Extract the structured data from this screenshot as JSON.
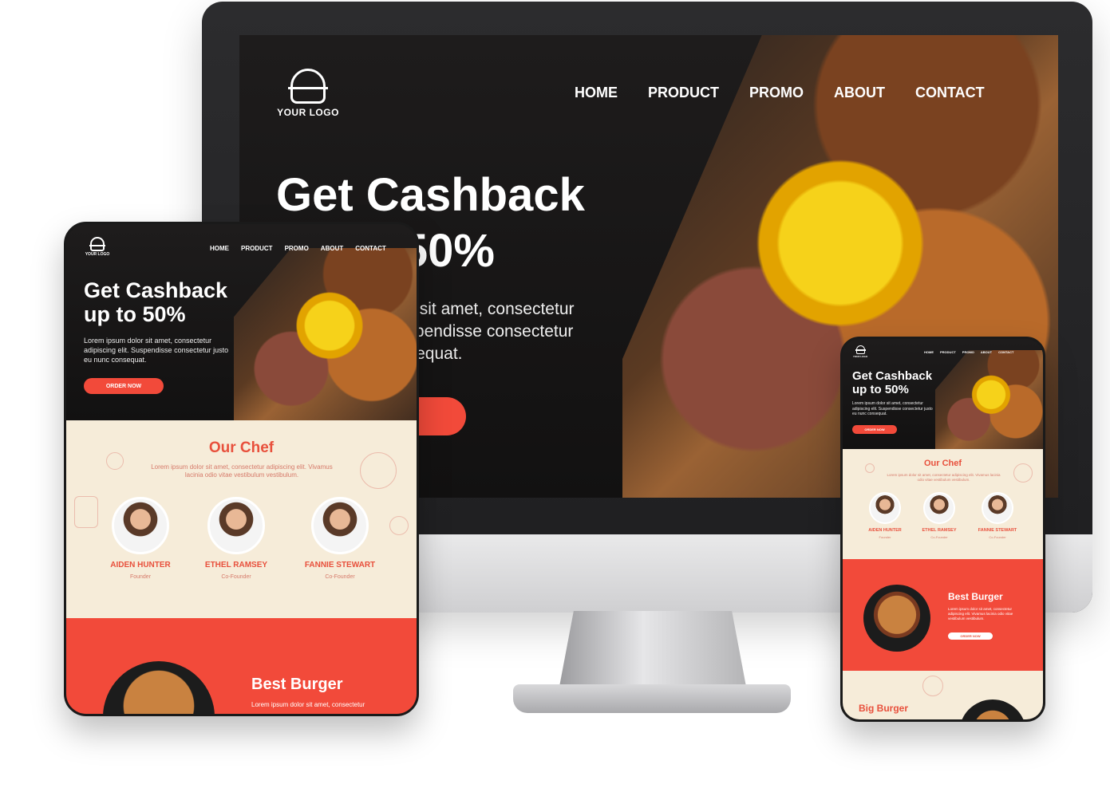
{
  "brand": {
    "logo_text": "YOUR LOGO",
    "accent": "#f24a3a",
    "dark": "#151414",
    "cream": "#f6ecd9"
  },
  "nav": [
    "HOME",
    "PRODUCT",
    "PROMO",
    "ABOUT",
    "CONTACT"
  ],
  "desktop": {
    "hero_title": "Get Cashback up to 50%",
    "hero_desc": "Lorem ipsum dolor sit amet, consectetur adipiscing elit. Suspendisse consectetur justo eu nunc consequat.",
    "cta": "ORDER NOW"
  },
  "tablet": {
    "hero_title": "Get Cashback up to 50%",
    "hero_desc": "Lorem ipsum dolor sit amet, consectetur adipiscing elit. Suspendisse consectetur justo eu nunc consequat.",
    "cta": "ORDER NOW",
    "chef_title": "Our Chef",
    "chef_desc": "Lorem ipsum dolor sit amet, consectetur adipiscing elit. Vivamus lacinia odio vitae vestibulum vestibulum.",
    "chefs": [
      {
        "name": "AIDEN HUNTER",
        "role": "Founder"
      },
      {
        "name": "ETHEL RAMSEY",
        "role": "Co-Founder"
      },
      {
        "name": "FANNIE STEWART",
        "role": "Co-Founder"
      }
    ],
    "best_title": "Best Burger",
    "best_desc": "Lorem ipsum dolor sit amet, consectetur"
  },
  "phone": {
    "hero_title": "Get Cashback up to 50%",
    "hero_desc": "Lorem ipsum dolor sit amet, consectetur adipiscing elit. Suspendisse consectetur justo eu nunc consequat.",
    "cta": "ORDER NOW",
    "chef_title": "Our Chef",
    "chef_desc": "Lorem ipsum dolor sit amet, consectetur adipiscing elit. Vivamus lacinia odio vitae vestibulum vestibulum.",
    "chefs": [
      {
        "name": "AIDEN HUNTER",
        "role": "Founder"
      },
      {
        "name": "ETHEL RAMSEY",
        "role": "Co-Founder"
      },
      {
        "name": "FANNIE STEWART",
        "role": "Co-Founder"
      }
    ],
    "best_title": "Best Burger",
    "best_desc": "Lorem ipsum dolor sit amet, consectetur adipiscing elit. Vivamus lacinia odio vitae vestibulum vestibulum.",
    "best_cta": "ORDER NOW",
    "big_title": "Big Burger"
  }
}
